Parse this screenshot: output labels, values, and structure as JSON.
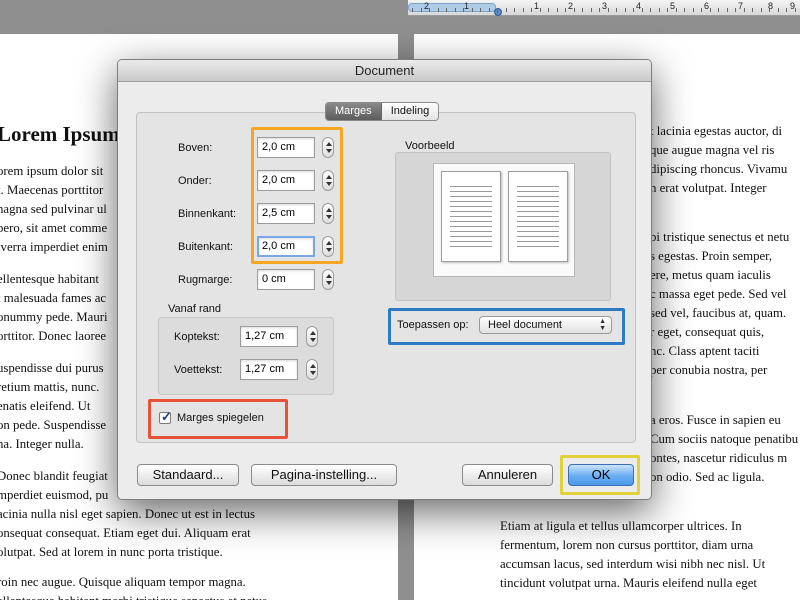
{
  "ruler": {
    "labels": [
      "2",
      "1",
      "1",
      "2",
      "3",
      "4",
      "5",
      "6",
      "7",
      "8",
      "9"
    ]
  },
  "document": {
    "heading": "Lorem Ipsum",
    "left_lines": [
      "orem ipsum dolor sit",
      "t. Maecenas porttitor",
      "nagna sed pulvinar ul",
      "bero, sit amet comme",
      "iverra imperdiet enim",
      "ellentesque habitant",
      "t malesuada fames ac",
      "onummy pede. Mauri",
      "orttitor. Donec laoree",
      "uspendisse dui purus",
      "retium mattis, nunc.",
      "enatis eleifend. Ut",
      "on pede. Suspendisse",
      "na. Integer nulla.",
      "Donec blandit feugiat",
      "mperdiet euismod, pu",
      "acinia nulla nisl eget sapien. Donec ut est in lectus",
      "onsequat consequat. Etiam eget dui. Aliquam erat",
      "olutpat. Sed at lorem in nunc porta tristique.",
      "roin nec augue. Quisque aliquam tempor magna.",
      "ellentesque habitant morbi tristique senectus et netus"
    ],
    "right_lines": [
      "t lacinia egestas auctor, di",
      "que augue magna vel ris",
      "dipiscing rhoncus. Vivamu",
      "n erat volutpat. Integer",
      "bi tristique senectus et netu",
      "s egestas. Proin semper,",
      "ere, metus quam iaculis",
      "c massa eget pede. Sed vel",
      "sed vel, faucibus at, quam.",
      "r eget, consequat quis,",
      "nc. Class aptent taciti",
      "per conubia nostra, per",
      "a eros. Fusce in sapien eu",
      "Cum sociis natoque penatibu",
      "ontes, nascetur ridiculus m",
      "on odio. Sed ac ligula.",
      "Etiam at ligula et tellus ullamcorper ultrices. In",
      "fermentum, lorem non cursus porttitor, diam urna",
      "accumsan lacus, sed interdum wisi nibh nec nisl. Ut",
      "tincidunt volutpat urna. Mauris eleifend nulla eget"
    ]
  },
  "dialog": {
    "title": "Document",
    "tabs": [
      {
        "label": "Marges",
        "selected": true
      },
      {
        "label": "Indeling",
        "selected": false
      }
    ],
    "margins": {
      "top_label": "Boven:",
      "top_value": "2,0 cm",
      "bottom_label": "Onder:",
      "bottom_value": "2,0 cm",
      "inside_label": "Binnenkant:",
      "inside_value": "2,5 cm",
      "outside_label": "Buitenkant:",
      "outside_value": "2,0 cm",
      "gutter_label": "Rugmarge:",
      "gutter_value": "0 cm"
    },
    "from_edge": {
      "group_label": "Vanaf rand",
      "header_label": "Koptekst:",
      "header_value": "1,27 cm",
      "footer_label": "Voettekst:",
      "footer_value": "1,27 cm"
    },
    "preview_label": "Voorbeeld",
    "apply_to_label": "Toepassen op:",
    "apply_to_value": "Heel document",
    "mirror_margins_label": "Marges spiegelen",
    "mirror_margins_checked": true,
    "buttons": {
      "default": "Standaard...",
      "page_setup": "Pagina-instelling...",
      "cancel": "Annuleren",
      "ok": "OK"
    }
  },
  "highlight_colors": {
    "margins": "#f5a623",
    "apply_to": "#2e7bc4",
    "mirror": "#e8523a",
    "ok": "#e2d23a"
  }
}
